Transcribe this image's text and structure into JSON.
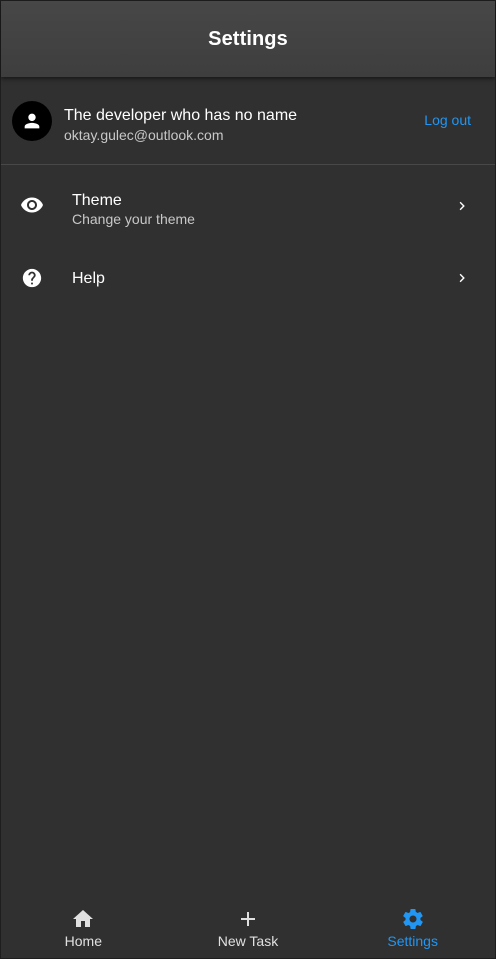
{
  "app_bar": {
    "title": "Settings"
  },
  "profile": {
    "name": "The developer who has no name",
    "email": "oktay.gulec@outlook.com",
    "logout_label": "Log out",
    "avatar_icon": "person-icon"
  },
  "settings_items": [
    {
      "title": "Theme",
      "subtitle": "Change your theme",
      "icon": "eye-icon"
    },
    {
      "title": "Help",
      "subtitle": "",
      "icon": "help-circle-icon"
    }
  ],
  "bottom_nav": [
    {
      "label": "Home",
      "icon": "home-icon",
      "active": false
    },
    {
      "label": "New Task",
      "icon": "plus-icon",
      "active": false
    },
    {
      "label": "Settings",
      "icon": "gear-icon",
      "active": true
    }
  ],
  "colors": {
    "accent": "#2196f3",
    "background": "#303030",
    "app_bar": "#424242"
  }
}
